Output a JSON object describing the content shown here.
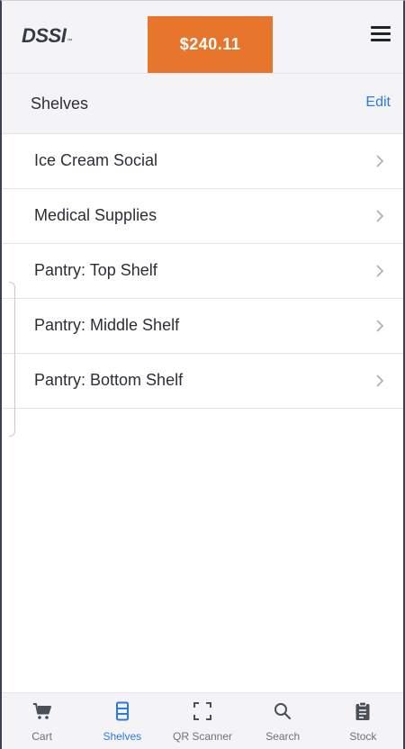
{
  "header": {
    "logo_text": "DSSI",
    "logo_tm": "™",
    "cart_total": "$240.11"
  },
  "colors": {
    "accent": "#e8752c",
    "link": "#2a7ae2",
    "header_bg": "#f4f4f6"
  },
  "section": {
    "title": "Shelves",
    "edit_label": "Edit"
  },
  "shelves": [
    {
      "label": "Ice Cream Social"
    },
    {
      "label": "Medical Supplies"
    },
    {
      "label": "Pantry: Top Shelf"
    },
    {
      "label": "Pantry: Middle Shelf"
    },
    {
      "label": "Pantry: Bottom Shelf"
    }
  ],
  "bottom_nav": [
    {
      "label": "Cart",
      "icon": "cart-icon",
      "active": false
    },
    {
      "label": "Shelves",
      "icon": "shelves-icon",
      "active": true
    },
    {
      "label": "QR Scanner",
      "icon": "qr-scanner-icon",
      "active": false
    },
    {
      "label": "Search",
      "icon": "search-icon",
      "active": false
    },
    {
      "label": "Stock",
      "icon": "clipboard-icon",
      "active": false
    }
  ]
}
